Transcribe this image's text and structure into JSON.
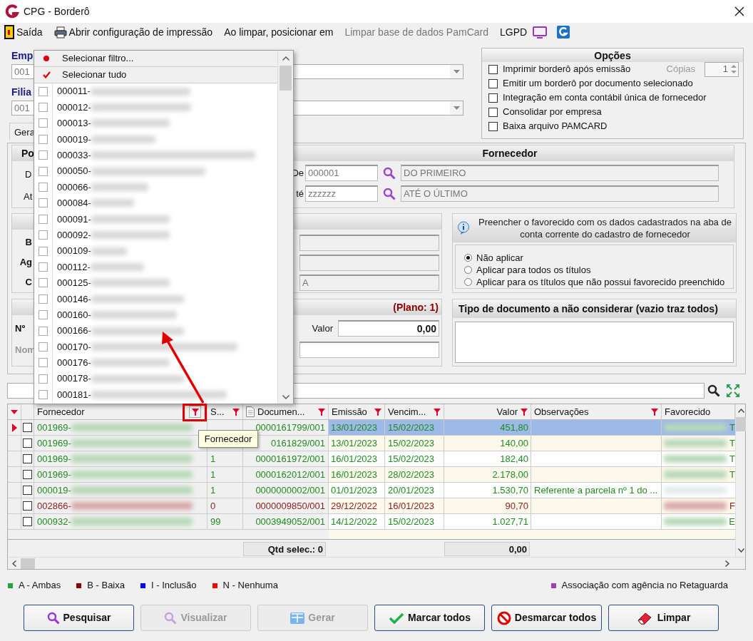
{
  "window": {
    "title": "CPG - Borderô"
  },
  "toolbar": [
    {
      "kind": "exit",
      "label": "Saída",
      "disabled": false
    },
    {
      "kind": "print",
      "label": "Abrir configuração de impressão",
      "disabled": false
    },
    {
      "kind": "text",
      "label": "Ao limpar, posicionar em",
      "disabled": false
    },
    {
      "kind": "text",
      "label": "Limpar base de dados PamCard",
      "disabled": true
    },
    {
      "kind": "monitor",
      "label": "LGPD",
      "disabled": false
    },
    {
      "kind": "logo"
    }
  ],
  "empresa": {
    "label": "Emp",
    "value": "001"
  },
  "filial": {
    "label": "Filia",
    "value": "001"
  },
  "tab": {
    "label": "Gera"
  },
  "options": {
    "title": "Opções",
    "checkboxes": [
      {
        "label": "Imprimir borderô após emissão",
        "checked": false
      },
      {
        "label": "Emitir um borderô por documento selecionado",
        "checked": false
      },
      {
        "label": "Integração em conta contábil única de fornecedor",
        "checked": false
      },
      {
        "label": "Consolidar por empresa",
        "checked": false
      },
      {
        "label": "Baixa arquivo PAMCARD",
        "checked": false
      }
    ],
    "copies": {
      "label": "Cópias",
      "value": "1",
      "disabled": true
    }
  },
  "periodo": {
    "title": "Po",
    "from_label": "D",
    "to_label": "At"
  },
  "fornecedor": {
    "title": "Fornecedor",
    "from": {
      "label": "De",
      "code": "000001",
      "name": "DO PRIMEIRO"
    },
    "to": {
      "label": "té",
      "code": "zzzzzz",
      "name": "ATÉ O ÚLTIMO"
    }
  },
  "banco": {
    "labels": [
      "B",
      "Ag",
      "C"
    ],
    "account_fragment": "A"
  },
  "favorecido_panel": {
    "info": "Preencher o favorecido com os dados cadastrados na aba de conta corrente do cadastro de fornecedor",
    "radios": [
      {
        "label": "Não aplicar",
        "selected": true
      },
      {
        "label": "Aplicar para todos os títulos",
        "selected": false
      },
      {
        "label": "Aplicar para os títulos que não possui favorecido preenchido",
        "selected": false
      }
    ]
  },
  "plano": {
    "title": "(Plano: 1)",
    "number_label": "Nº",
    "name_label": "Nom",
    "valor_label": "Valor",
    "valor": "0,00"
  },
  "tipo_documento": {
    "title": "Tipo de documento a não considerar (vazio traz todos)"
  },
  "grid": {
    "columns": [
      {
        "label": "Fornecedor",
        "filter": true
      },
      {
        "label": "S...",
        "filter": true
      },
      {
        "label": "Documen...",
        "filter": true
      },
      {
        "label": "Emissão",
        "filter": true
      },
      {
        "label": "Vencim...",
        "filter": true
      },
      {
        "label": "Valor",
        "filter": true
      },
      {
        "label": "Observações",
        "filter": true
      },
      {
        "label": "Favorecido",
        "filter": false
      }
    ],
    "rows": [
      {
        "fornecedor": "001969-",
        "documento": "0000161799/001",
        "emissao": "13/01/2023",
        "vencimento": "15/02/2023",
        "valor": "451,80",
        "favorecido": "T",
        "color": "#1e8c1e",
        "selected": true,
        "checked": false
      },
      {
        "fornecedor": "001969-",
        "documento": "0161829/001",
        "emissao": "13/01/2023",
        "vencimento": "15/02/2023",
        "valor": "140,00",
        "favorecido": "T",
        "color": "#1e8c1e",
        "selected": false,
        "checked": false
      },
      {
        "fornecedor": "001969-",
        "s": "1",
        "documento": "0000161972/001",
        "emissao": "16/01/2023",
        "vencimento": "15/02/2023",
        "valor": "182,40",
        "favorecido": "T",
        "color": "#1e8c1e",
        "selected": false,
        "checked": false
      },
      {
        "fornecedor": "001969-",
        "s": "1",
        "documento": "0000162012/001",
        "emissao": "16/01/2023",
        "vencimento": "28/02/2023",
        "valor": "2.178,00",
        "favorecido": "T",
        "color": "#1e8c1e",
        "selected": false,
        "checked": false
      },
      {
        "fornecedor": "000019-",
        "s": "1",
        "documento": "0000000002/001",
        "emissao": "01/01/2023",
        "vencimento": "20/01/2023",
        "valor": "1.530,70",
        "observacoes": "Referente a parcela nº 1 do ...",
        "color": "#1e8c1e",
        "selected": false,
        "checked": false
      },
      {
        "fornecedor": "002866-",
        "s": "0",
        "documento": "0000009850/001",
        "emissao": "29/12/2022",
        "vencimento": "16/01/2023",
        "valor": "90,70",
        "favorecido": "F",
        "color": "#8b1a1a",
        "selected": false,
        "checked": false
      },
      {
        "fornecedor": "000932-",
        "s": "99",
        "documento": "0003949052/001",
        "emissao": "14/12/2022",
        "vencimento": "15/02/2023",
        "valor": "1.027,71",
        "favorecido": "E",
        "color": "#1e8c1e",
        "selected": false,
        "checked": false
      }
    ],
    "footer": {
      "count": "Qtd selec.: 0",
      "total": "0,00"
    }
  },
  "legend": [
    {
      "label": "A - Ambas",
      "color": "#1fa33a"
    },
    {
      "label": "B - Baixa",
      "color": "#8b0000"
    },
    {
      "label": "I - Inclusão",
      "color": "#0000ff"
    },
    {
      "label": "N - Nenhuma",
      "color": "#ff0000"
    },
    {
      "label": "Associação com agência no Retaguarda",
      "color": "#a040b0"
    }
  ],
  "buttons": [
    {
      "label": "Pesquisar",
      "kind": "search",
      "disabled": false
    },
    {
      "label": "Visualizar",
      "kind": "search",
      "disabled": true
    },
    {
      "label": "Gerar",
      "kind": "grid",
      "disabled": true
    },
    {
      "label": "Marcar todos",
      "kind": "check",
      "disabled": false
    },
    {
      "label": "Desmarcar todos",
      "kind": "forbidden",
      "disabled": false
    },
    {
      "label": "Limpar",
      "kind": "eraser",
      "disabled": false
    }
  ],
  "dropdown": {
    "filter_label": "Selecionar filtro...",
    "select_all_label": "Selecionar tudo",
    "select_all_checked": true,
    "items": [
      {
        "code": "000011-",
        "checked": false
      },
      {
        "code": "000012-",
        "checked": false
      },
      {
        "code": "000013-",
        "checked": false
      },
      {
        "code": "000019-",
        "checked": false
      },
      {
        "code": "000033-",
        "checked": false
      },
      {
        "code": "000050-",
        "checked": false
      },
      {
        "code": "000066-",
        "checked": false
      },
      {
        "code": "000084-",
        "checked": false
      },
      {
        "code": "000091-",
        "checked": false
      },
      {
        "code": "000092-",
        "checked": false
      },
      {
        "code": "000109-",
        "checked": false
      },
      {
        "code": "000112-",
        "checked": false
      },
      {
        "code": "000125-",
        "checked": false
      },
      {
        "code": "000146-",
        "checked": false
      },
      {
        "code": "000160-",
        "checked": false
      },
      {
        "code": "000166-",
        "checked": false
      },
      {
        "code": "000170-",
        "checked": false
      },
      {
        "code": "000176-",
        "checked": false
      },
      {
        "code": "000178-",
        "checked": false
      },
      {
        "code": "000181-",
        "checked": false
      }
    ]
  },
  "tooltip": {
    "text": "Fornecedor"
  }
}
